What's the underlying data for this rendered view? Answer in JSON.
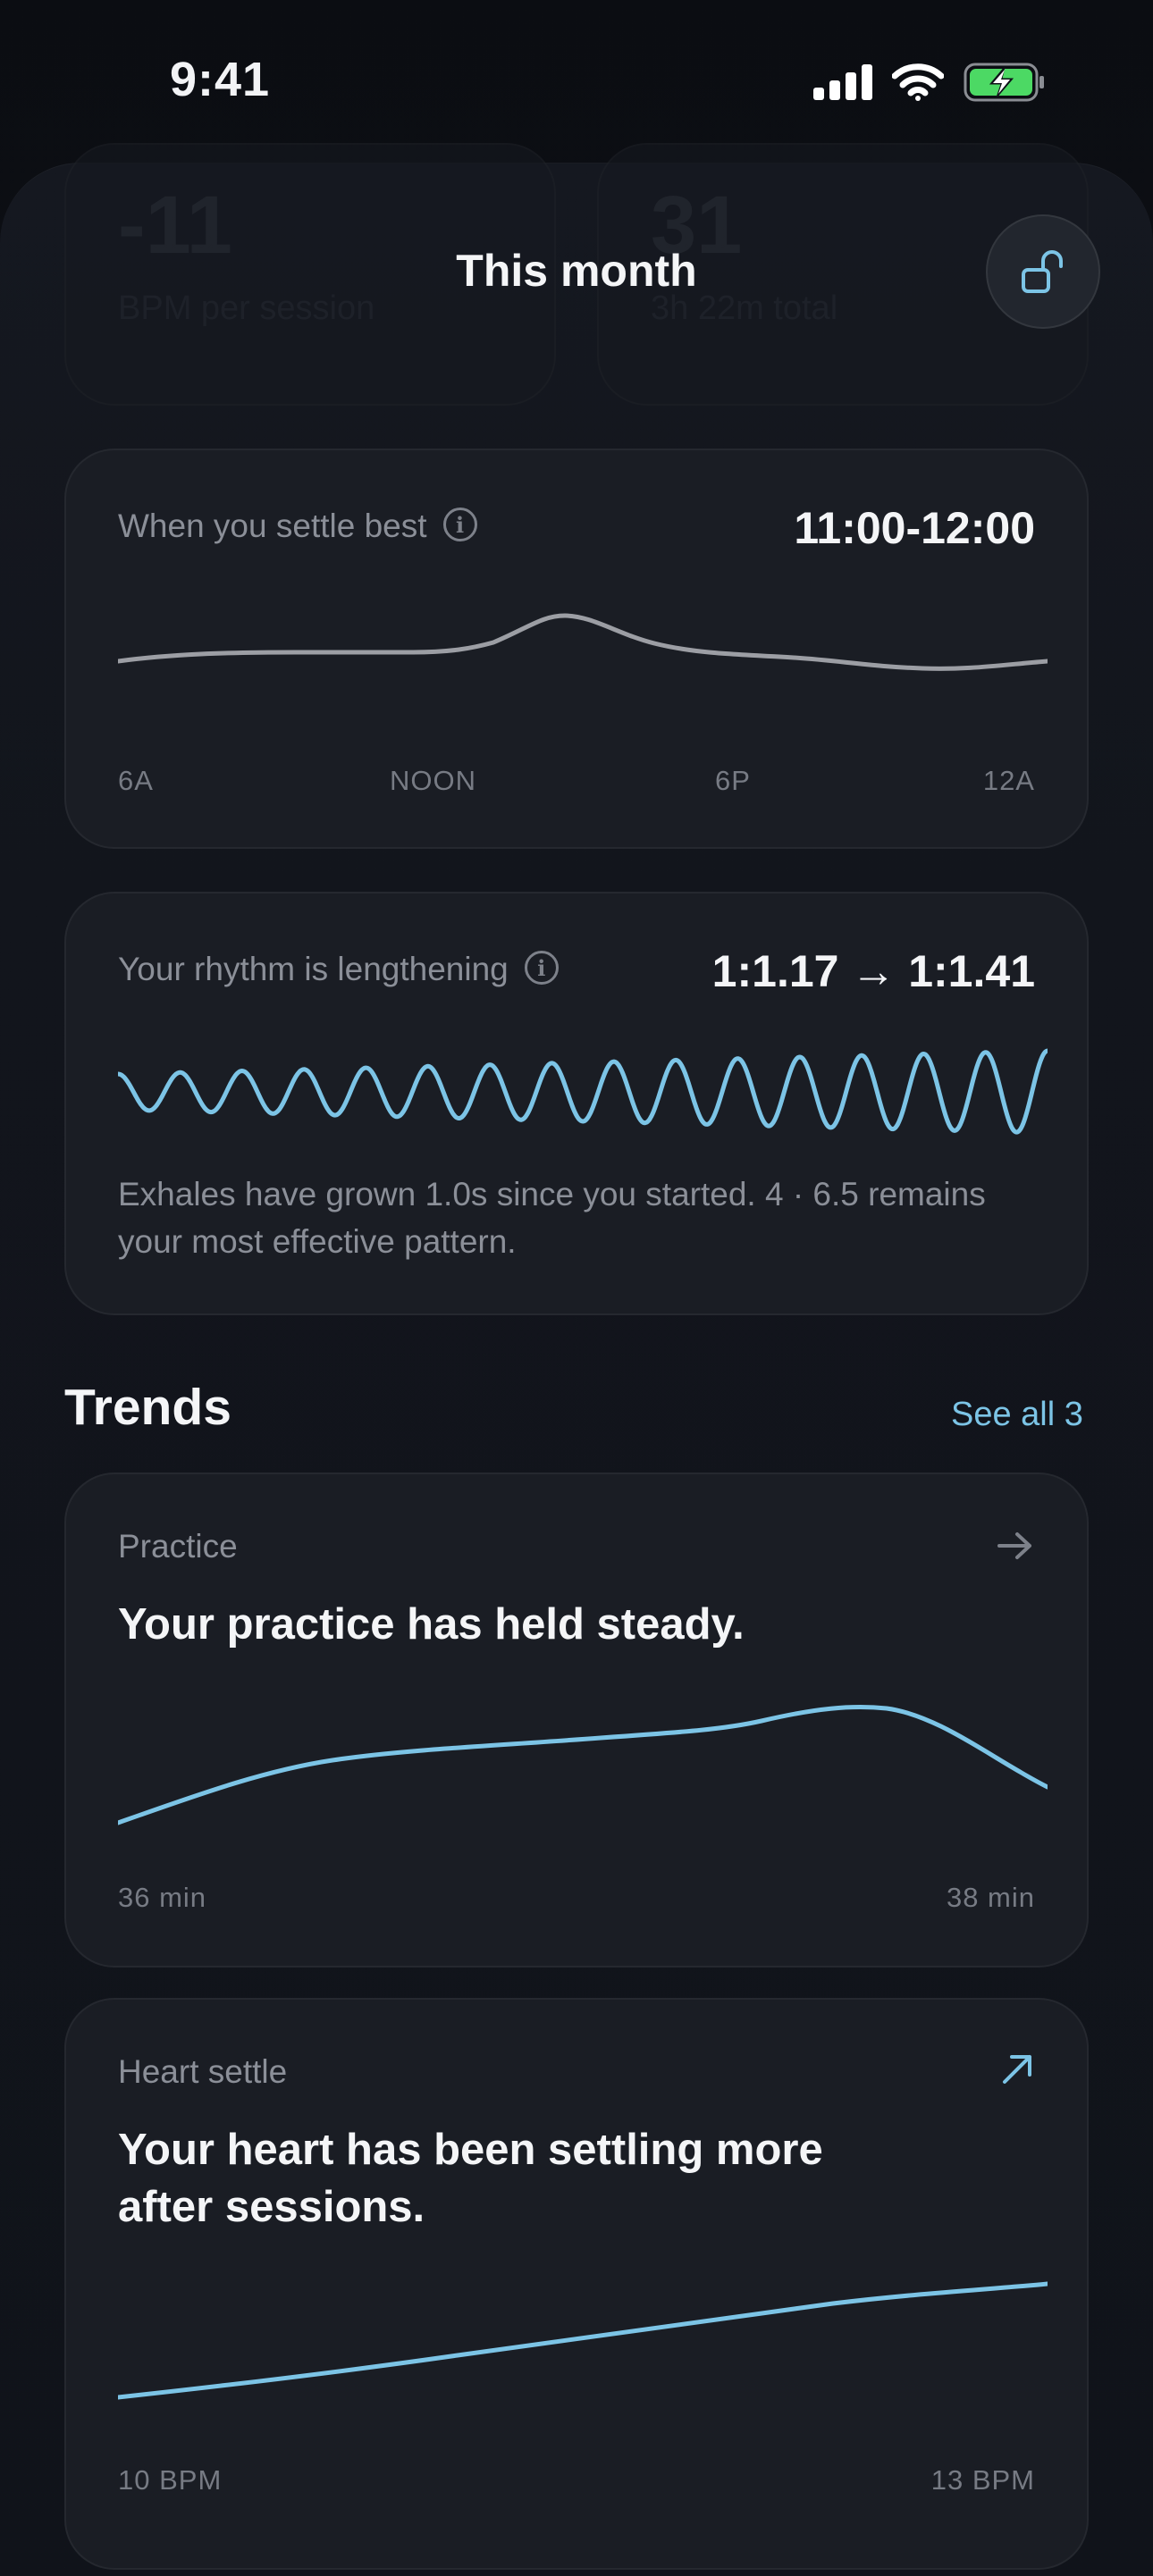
{
  "status_bar": {
    "time": "9:41"
  },
  "header": {
    "title": "This month",
    "lock_icon": "unlock-icon"
  },
  "summary_cards": [
    {
      "value": "-11",
      "sub": "BPM per session"
    },
    {
      "value": "31",
      "sub": "3h 22m total"
    }
  ],
  "settle_card": {
    "label": "When you settle best",
    "value": "11:00-12:00",
    "ticks": [
      "6A",
      "NOON",
      "6P",
      "12A"
    ]
  },
  "rhythm_card": {
    "label": "Your rhythm is lengthening",
    "value": "1:1.17 → 1:1.41",
    "body": "Exhales have grown 1.0s since you started. 4 · 6.5 remains your most effective pattern."
  },
  "trends": {
    "title": "Trends",
    "see_all": "See all 3",
    "cards": [
      {
        "label": "Practice",
        "headline": "Your practice has held steady.",
        "start": "36 min",
        "end": "38 min",
        "arrow_icon": "arrow-right-icon"
      },
      {
        "label": "Heart settle",
        "headline_line1": "Your heart has been settling more",
        "headline_line2": "after sessions.",
        "start": "10 BPM",
        "end": "13 BPM",
        "arrow_icon": "arrow-up-right-icon"
      }
    ]
  },
  "colors": {
    "accent": "#7cc4e6",
    "card": "#1a1d24",
    "background": "#0d1016"
  }
}
